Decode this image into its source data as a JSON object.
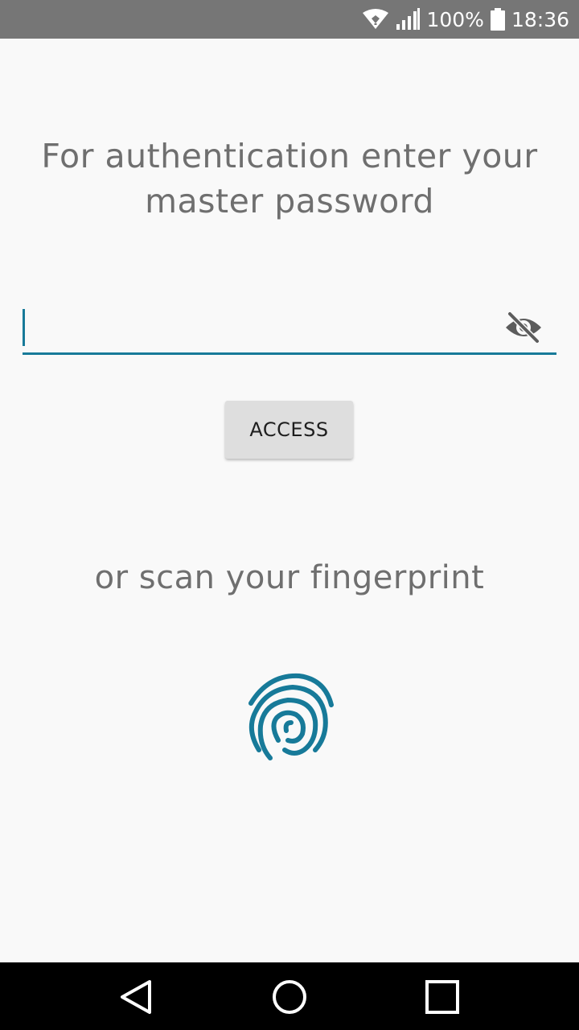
{
  "status_bar": {
    "battery_percent": "100%",
    "time": "18:36",
    "icons": [
      "wifi-icon",
      "signal-icon",
      "battery-icon"
    ]
  },
  "auth": {
    "prompt": "For authentication enter your master password",
    "password_value": "",
    "visibility_icon": "eye-off-icon",
    "access_label": "ACCESS",
    "or_scan": "or scan your fingerprint",
    "fingerprint_icon": "fingerprint-icon"
  },
  "nav_bar": {
    "icons": [
      "back-icon",
      "home-icon",
      "recents-icon"
    ]
  },
  "colors": {
    "accent": "#177a99",
    "status_bar": "#767676",
    "background": "#f9f9f9",
    "text_muted": "#6f6f6f",
    "button_bg": "#dedede",
    "nav_bar": "#000000"
  }
}
